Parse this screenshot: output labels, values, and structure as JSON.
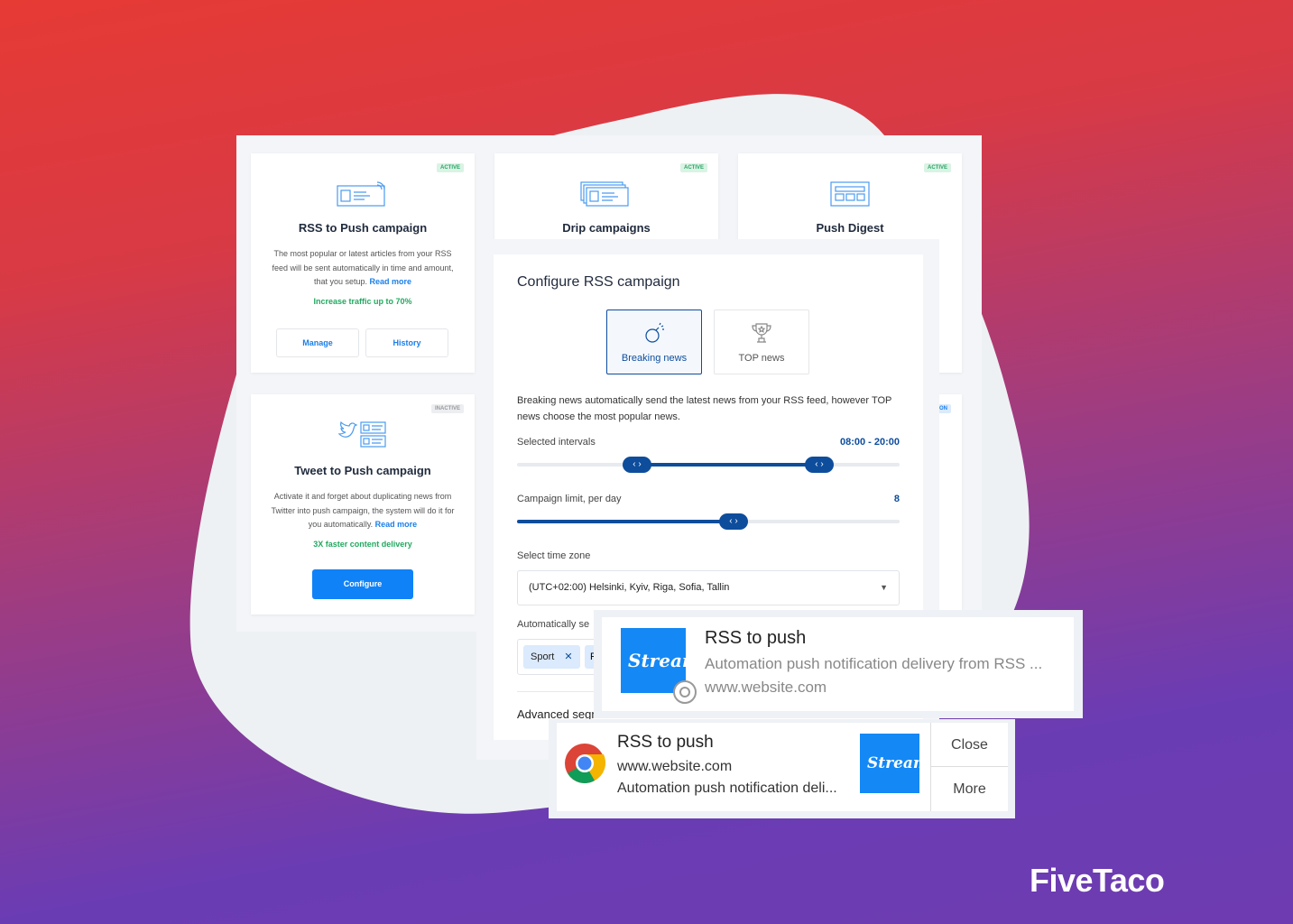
{
  "brand": "FiveTaco",
  "colors": {
    "accent": "#1082f7",
    "dark_blue": "#0d4d9c",
    "green": "#22a860"
  },
  "cards": [
    {
      "title": "RSS to Push campaign",
      "badge": "ACTIVE",
      "icon": "rss-newspaper-icon",
      "desc": "The most popular or latest articles from your RSS feed will be sent automatically in time and amount, that you setup.",
      "read_more": "Read more",
      "highlight": "Increase traffic up to 70%",
      "buttons": [
        "Manage",
        "History"
      ]
    },
    {
      "title": "Drip campaigns",
      "badge": "ACTIVE",
      "icon": "stacked-cards-icon"
    },
    {
      "title": "Push Digest",
      "badge": "ACTIVE",
      "icon": "digest-grid-icon"
    },
    {
      "title": "Tweet to Push campaign",
      "badge": "INACTIVE",
      "icon": "twitter-icon",
      "desc": "Activate it and forget about duplicating news from Twitter into push campaign, the system will do it for you automatically.",
      "read_more": "Read more",
      "highlight": "3X faster content delivery",
      "button": "Configure"
    },
    {
      "badge": "ON"
    }
  ],
  "config": {
    "title": "Configure RSS campaign",
    "options": [
      {
        "label": "Breaking news",
        "icon": "bomb-icon",
        "selected": true
      },
      {
        "label": "TOP news",
        "icon": "trophy-icon",
        "selected": false
      }
    ],
    "desc": "Breaking news automatically send the latest news from your RSS feed, however TOP news choose the most popular news.",
    "interval_label": "Selected intervals",
    "interval_value": "08:00 - 20:00",
    "interval_range": [
      8,
      20
    ],
    "limit_label": "Campaign limit, per day",
    "limit_value": "8",
    "timezone_label": "Select time zone",
    "timezone_value": "(UTC+02:00) Helsinki, Kyiv, Riga, Sofia, Tallin",
    "auto_label": "Automatically se",
    "tags": [
      "Sport",
      "F"
    ],
    "advanced_label": "Advanced segm"
  },
  "notif1": {
    "logo": "Stream",
    "title": "RSS to push",
    "body": "Automation push notification delivery from RSS ...",
    "site": "www.website.com"
  },
  "notif2": {
    "title": "RSS to push",
    "site": "www.website.com",
    "body": "Automation push notification deli...",
    "logo": "Stream",
    "close": "Close",
    "more": "More"
  }
}
